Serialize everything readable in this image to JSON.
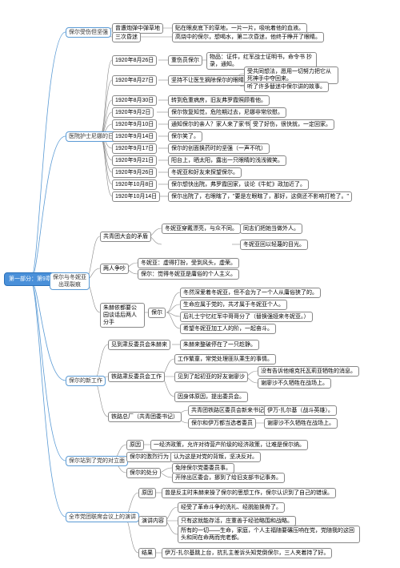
{
  "root": "第一部分：第9章",
  "b1": {
    "t": "保尔受伤但坚强",
    "c1": "曾遭炮弹中弹草地",
    "c1a": "贴在眼皮底下的草地，一片一片，吸吮着他的血液。",
    "c2": "三次昏迷",
    "c2a": "高烧中的保尔，想喝水，第二次昏迷，他终于睁开了眼睛。"
  },
  "b2": {
    "t": "医院护士尼娜的日记",
    "d1": "1920年8月26日",
    "d1a": "重伤员保尔",
    "d1b": "物品：证件，红军战士证明书，命令书 抄录，通知。",
    "d2": "1920年8月27日",
    "d2a": "坚持不让医生摘除保尔的眼睛",
    "d2b1": "受共同想法，愿用一切努力把它从死神手中夺回来。",
    "d2b2": "听了许多替迷中保尔讲的故事。",
    "d3": "1920年8月30日",
    "d3a": "转到危重病房，旧友弗罗霞照顾看他。",
    "d4": "1920年9月2日",
    "d4a": "保尔恢复知觉，危险期过去，尼娜非常欣慰。",
    "d5": "1920年9月10日",
    "d5a": "通知保尔的亲人？家人来了家书。",
    "d5b": "受了好伤，很快就，一定回家。",
    "d6": "1920年9月14日",
    "d6a": "保尔笑了。",
    "d7": "1920年9月17日",
    "d7a": "保尔的创面换药时的坚强（一声不吭）",
    "d8": "1920年9月21日",
    "d8a": "阳台上，晒太阳，露出一只眼睛的浅浅微笑。",
    "d9": "1920年9月26日",
    "d9a": "冬妮亚和好友来探望保尔。",
    "d10": "1920年10月8日",
    "d10a": "保尔想快出院，弗罗霞回家，谈论《牛虻》政加近了。",
    "d11": "1920年10月14日",
    "d11a": "保尔出院了，右眼瞎了，\"要是左眼瞎了，那好，这倒还不影响打枪了。\""
  },
  "b3": {
    "t": "保尔与冬妮亚出现裂痕",
    "c1": "共青团大会的矛盾",
    "c1a": "冬妮亚穿戴漂亮，与众不同。",
    "c1b": "同志们把她当做外人。",
    "c1c": "冬妮亚回以轻蔑的目光。",
    "c2": "两人争吵",
    "c2a": "冬妮亚：虚得打扮，受到风头，虚荣。",
    "c2b": "保尔：觉得冬妮亚是庸俗的个人主义。",
    "c3": "朱赫依都要公园谈话后两人分手",
    "c3t": "保尔",
    "c3a": "冬然深爱着冬妮亚，但不会为了一个人从庸俗狭了的。",
    "c3b": "生命应属于党的，共才属于冬妮亚个人。",
    "c3c": "后礼士宁忆红军中哥哥分了（替换强娅来冬妮亚。）",
    "c3d": "希望冬妮亚加工人的阶，一起奋斗。"
  },
  "b4": {
    "t": "保尔的新工作",
    "c1": "见到肃反委员会朱赫来",
    "c1a": "朱赫来整破停在了一只趁静。",
    "c2": "铁路肃反委员会工作",
    "c2a": "工作繁童，常党处理匪队乘生的事情。",
    "c2b": "见到了起初亚的好友谢廖沙",
    "c2b1": "没有告诉他维克托瓦莉亚牺牲的消息。",
    "c2b2": "谢廖沙不久牺牲在战场上。",
    "c2c": "因身体原因，提出委员会。",
    "c3t": "铁路总厂（共青团委书记）",
    "c3a": "共青团铁路区委员会新来书记",
    "c3a1": "伊万-扎尔基（战斗英雄）。",
    "c3b": "保尔和伊万都当选者委员",
    "c3b1": "谢廖沙不久牺牲在战场上。"
  },
  "b5": {
    "t": "保尔站到了党的对立面",
    "c1": "原因",
    "c1a": "一经济政策，允许对待营产阶级的经济政策，让难是保尔纳。",
    "c2": "保尔的激烈行为",
    "c2a": "认为这是对党的背叛，坚决反对。",
    "c3": "保尔的处分",
    "c3a": "免除保尔党委委员事。",
    "c3b": "开除出区委会，挪到了给旧支部书记事务。"
  },
  "b6": {
    "t": "全市党团联席会议上的演讲",
    "c1": "原因",
    "c1a": "曾是反主时朱赫来操了保尔的思想工作，保尔认识到了自己的错误。",
    "c2": "演讲内容",
    "c2a": "经受了革命斗争的洗礼、经脱胎换骨了。",
    "c2b": "只有这就能存活，庄重善于经验略围和战略。",
    "c2c": "所有的一切——生命，家庭，个人主福随要碾压响在党，党随我的这回头和同在命两而完老都。",
    "c3": "结果",
    "c3a": "伊万-扎尔基跳上台，抗扎主差诉头知党倒保尔，三人夹着持了好。"
  }
}
